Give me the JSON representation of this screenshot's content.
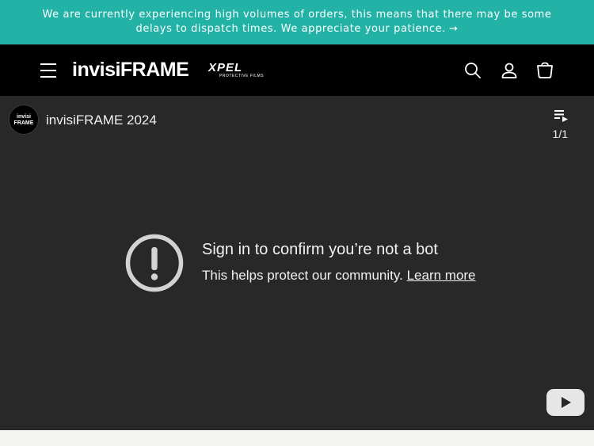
{
  "announcement": {
    "line1": "We are currently experiencing high volumes of orders, this means that there may be some",
    "line2": "delays to dispatch times. We appreciate your patience.",
    "arrow": "→"
  },
  "header": {
    "brand": "invisiFRAME",
    "partner_logo": "XPEL",
    "partner_sub": "PROTECTIVE FILMS",
    "icons": [
      "menu-icon",
      "search-icon",
      "account-icon",
      "cart-icon"
    ]
  },
  "player": {
    "channel_avatar_text_1": "invisi",
    "channel_avatar_text_2": "FRAME",
    "video_title": "invisiFRAME 2024",
    "playlist_count": "1/1",
    "message_title": "Sign in to confirm you’re not a bot",
    "message_body": "This helps protect our community.",
    "learn_more": "Learn more",
    "icons": [
      "playlist-icon",
      "alert-icon",
      "youtube-icon"
    ]
  },
  "colors": {
    "announcement_bg": "#22b2a6",
    "header_bg": "#000000",
    "player_bg": "#282828"
  }
}
